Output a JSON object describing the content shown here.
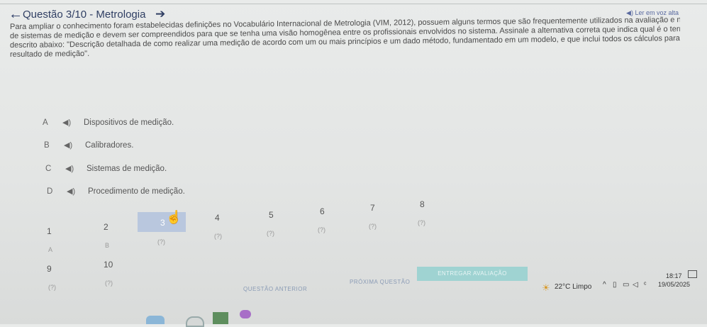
{
  "header": {
    "title": "Questão 3/10 - Metrologia",
    "tts_label": "◀) Ler em voz alta"
  },
  "question": {
    "lines": [
      "Para ampliar o conhecimento foram estabelecidas definições no Vocabulário Internacional de Metrologia (VIM, 2012), possuem alguns termos que são frequentemente utilizados na avaliação e na análise",
      "de sistemas de medição e devem ser compreendidos para que se tenha uma visão homogênea entre os profissionais envolvidos no sistema.   Assinale a alternativa correta que indica qual é o termo",
      "descrito abaixo: \"Descrição detalhada de como realizar uma medição de acordo com um ou mais princípios e um dado método, fundamentado em um modelo, e que inclui todos os cálculos para obter um",
      "resultado de medição\"."
    ]
  },
  "options": [
    {
      "letter": "A",
      "text": "Dispositivos de medição."
    },
    {
      "letter": "B",
      "text": "Calibradores."
    },
    {
      "letter": "C",
      "text": "Sistemas de medição."
    },
    {
      "letter": "D",
      "text": "Procedimento de medição."
    }
  ],
  "speaker_glyph": "◀)",
  "navigator": {
    "numbers": [
      "1",
      "2",
      "3",
      "4",
      "5",
      "6",
      "7",
      "8",
      "9",
      "10"
    ],
    "answers": [
      "A",
      "B",
      "(?)",
      "(?)",
      "(?)",
      "(?)",
      "(?)",
      "(?)",
      "(?)",
      "(?)"
    ],
    "current": "3"
  },
  "buttons": {
    "prev": "QUESTÃO ANTERIOR",
    "next": "PRÓXIMA QUESTÃO",
    "submit": "ENTREGAR AVALIAÇÃO"
  },
  "taskbar": {
    "weather": "22°C  Limpo",
    "time": "18:17",
    "date": "19/05/2025"
  },
  "colors": {
    "accent": "#2f3e63",
    "current_question": "#b9c7de",
    "submit": "#9fd3d2"
  }
}
